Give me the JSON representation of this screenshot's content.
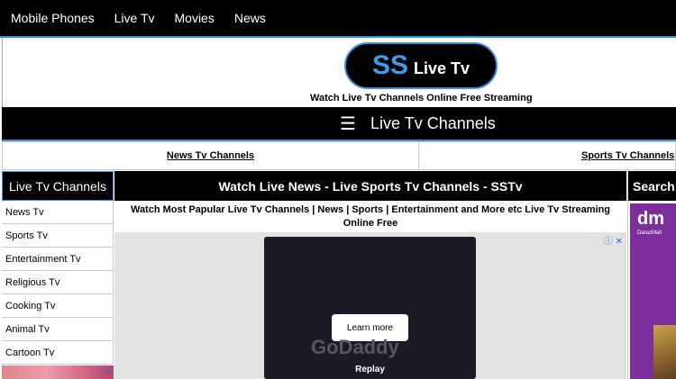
{
  "nav": {
    "items": [
      {
        "label": "Mobile Phones"
      },
      {
        "label": "Live Tv"
      },
      {
        "label": "Movies"
      },
      {
        "label": "News"
      }
    ]
  },
  "header": {
    "logo_main": "SS",
    "logo_sub": "Live Tv",
    "tagline": "Watch Live Tv Channels Online Free Streaming"
  },
  "channels_bar": {
    "menu_icon": "hamburger-icon",
    "title": "Live Tv Channels"
  },
  "categories": [
    {
      "label": "News Tv Channels"
    },
    {
      "label": "Sports Tv Channels"
    }
  ],
  "left_sidebar": {
    "title": "Live Tv Channels",
    "items": [
      {
        "label": "News Tv"
      },
      {
        "label": "Sports Tv"
      },
      {
        "label": "Entertainment Tv"
      },
      {
        "label": "Religious Tv"
      },
      {
        "label": "Cooking Tv"
      },
      {
        "label": "Animal Tv"
      },
      {
        "label": "Cartoon Tv"
      }
    ]
  },
  "main": {
    "title": "Watch Live News - Live Sports Tv Channels - SSTv",
    "description": "Watch Most Papular Live Tv Channels | News | Sports | Entertainment and More etc Live Tv Streaming Online Free",
    "ad": {
      "cta": "Learn more",
      "brand": "GoDaddy",
      "replay": "Replay",
      "info_icon": "adchoices-icon"
    }
  },
  "right_sidebar": {
    "title": "Search:",
    "ad_logo": "dm",
    "ad_caption": "DarazMall"
  },
  "colors": {
    "accent": "#3a8ee6",
    "bar": "#000000",
    "ad_purple": "#7b2e9c"
  }
}
